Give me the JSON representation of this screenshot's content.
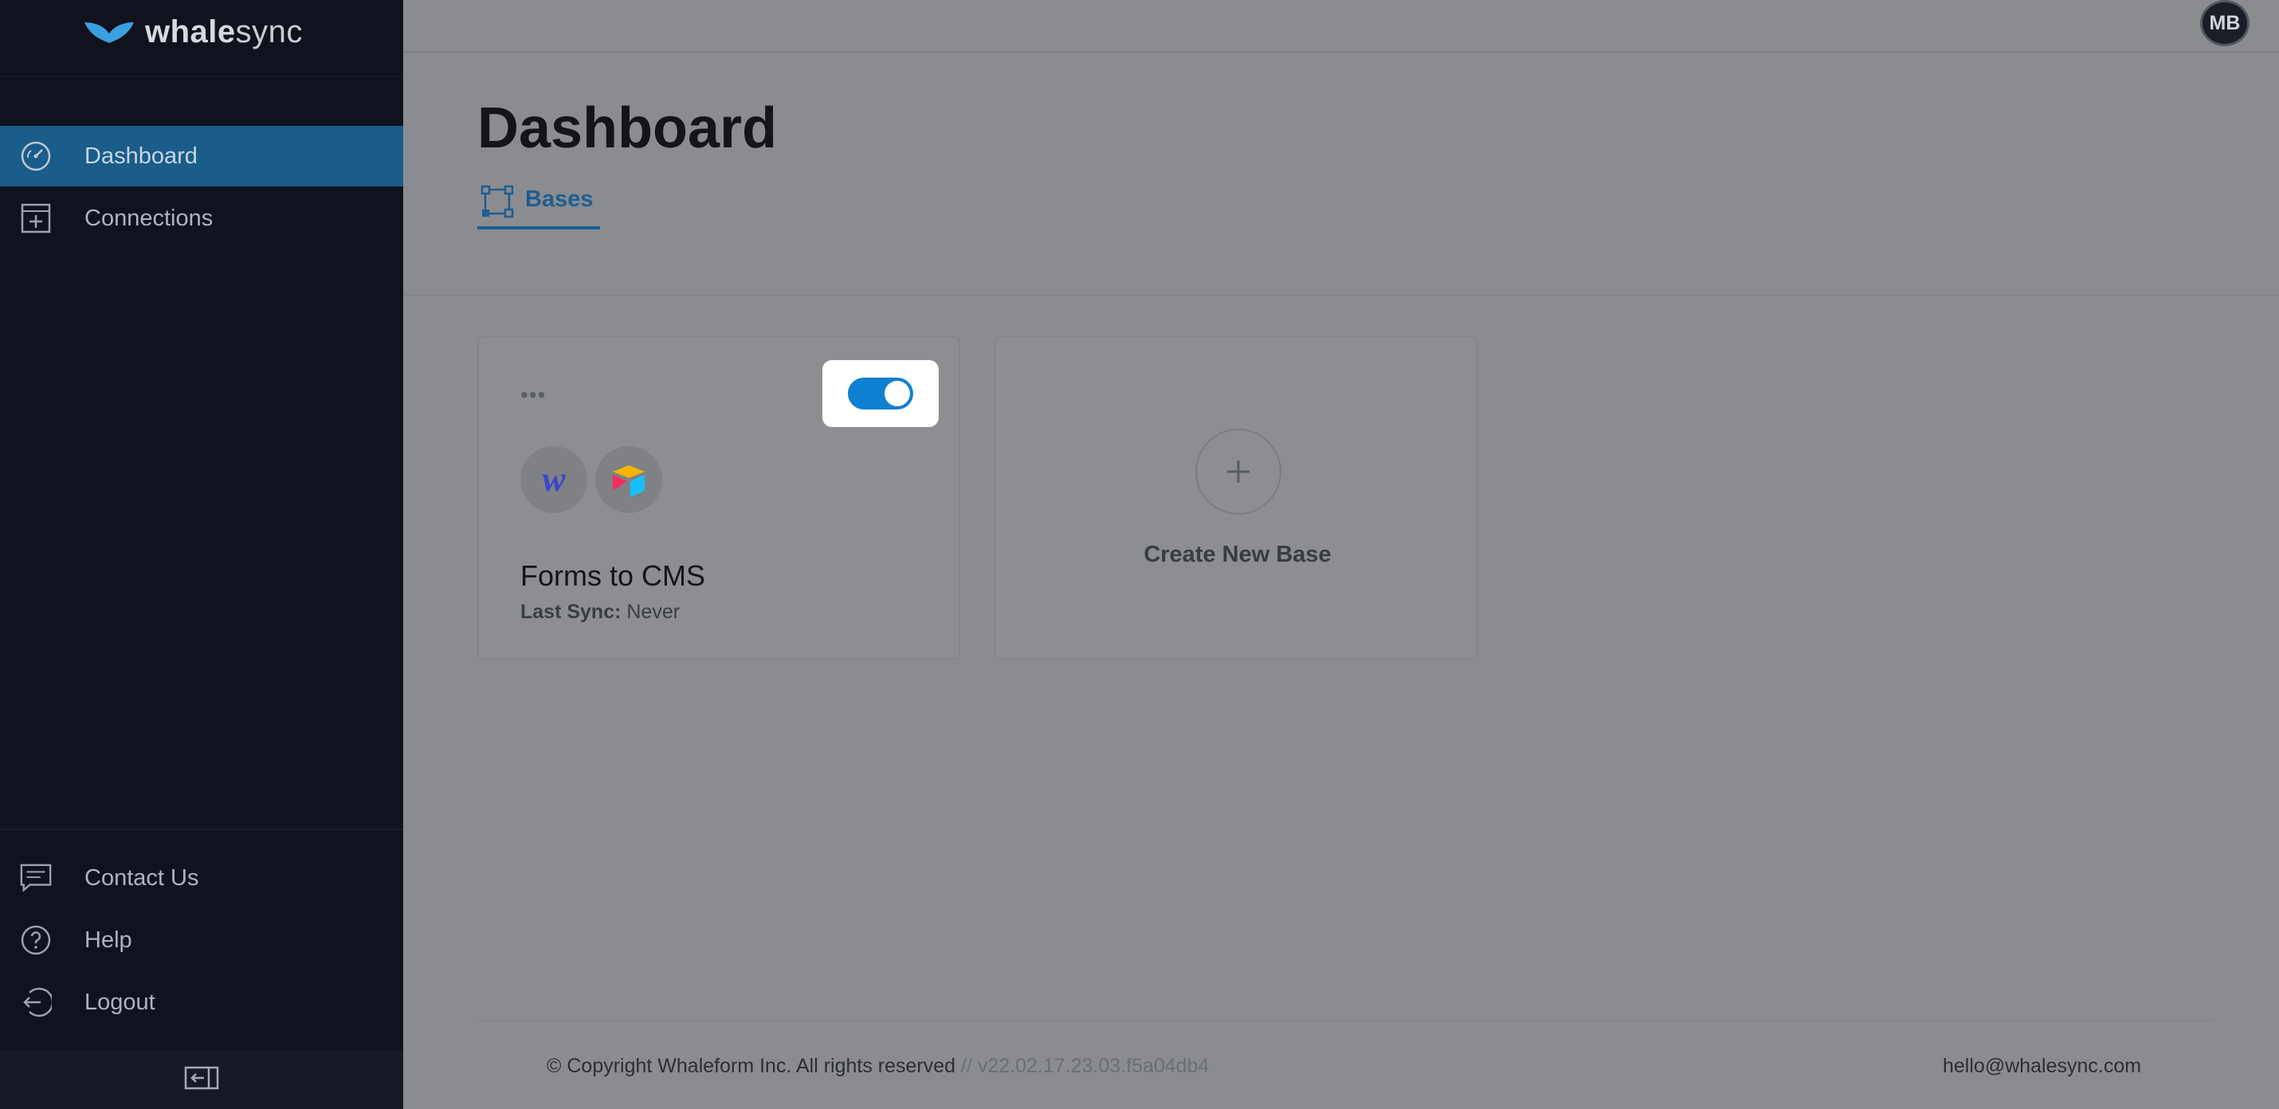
{
  "brand": {
    "name_bold": "whale",
    "name_regular": "sync",
    "logo_icon": "whale-tail-icon"
  },
  "sidebar": {
    "items": [
      {
        "label": "Dashboard",
        "icon": "gauge-icon",
        "active": true
      },
      {
        "label": "Connections",
        "icon": "add-window-icon",
        "active": false
      }
    ],
    "bottom_items": [
      {
        "label": "Contact Us",
        "icon": "chat-icon"
      },
      {
        "label": "Help",
        "icon": "help-circle-icon"
      },
      {
        "label": "Logout",
        "icon": "logout-icon"
      }
    ],
    "collapse_icon": "collapse-sidebar-icon"
  },
  "header": {
    "avatar_initials": "MB"
  },
  "main": {
    "title": "Dashboard",
    "tabs": [
      {
        "label": "Bases",
        "icon": "bases-icon"
      }
    ],
    "bases": [
      {
        "title": "Forms to CMS",
        "last_sync_label": "Last Sync:",
        "last_sync_value": "Never",
        "menu_glyph": "•••",
        "sync_enabled": true,
        "apps": [
          "webflow-icon",
          "airtable-icon"
        ],
        "webflow_letter": "w"
      }
    ],
    "create_base_label": "Create New Base"
  },
  "footer": {
    "copyright": "© Copyright Whaleform Inc. All rights reserved",
    "version": "// v22.02.17.23.03.f5a04db4",
    "email": "hello@whalesync.com"
  },
  "colors": {
    "accent": "#0f7fd1",
    "sidebar_bg": "#10121d",
    "active_nav": "#1a5c8a",
    "tab_accent": "#1c5e94"
  }
}
